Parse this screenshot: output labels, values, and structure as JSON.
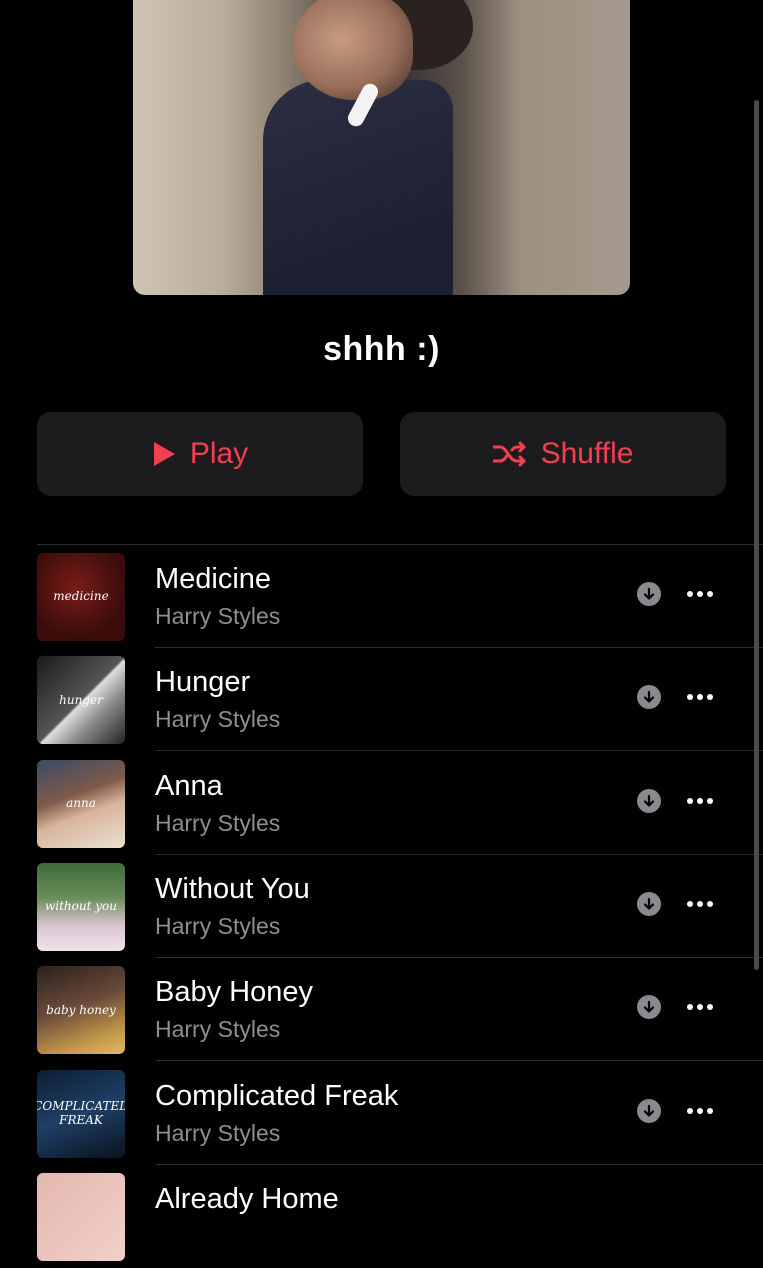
{
  "playlist": {
    "title": "shhh :)",
    "play_label": "Play",
    "shuffle_label": "Shuffle"
  },
  "colors": {
    "accent": "#f2404e",
    "button_bg": "#1c1c1e",
    "secondary_text": "#8e8e93"
  },
  "icons": {
    "download": "download-circle-icon",
    "more": "ellipsis-icon",
    "play": "play-icon",
    "shuffle": "shuffle-icon"
  },
  "tracks": [
    {
      "title": "Medicine",
      "artist": "Harry Styles",
      "art_text": "medicine"
    },
    {
      "title": "Hunger",
      "artist": "Harry Styles",
      "art_text": "hunger"
    },
    {
      "title": "Anna",
      "artist": "Harry Styles",
      "art_text": "anna"
    },
    {
      "title": "Without You",
      "artist": "Harry Styles",
      "art_text": "without you"
    },
    {
      "title": "Baby Honey",
      "artist": "Harry Styles",
      "art_text": "baby honey"
    },
    {
      "title": "Complicated Freak",
      "artist": "Harry Styles",
      "art_text": "COMPLICATED FREAK"
    },
    {
      "title": "Already Home",
      "artist": "",
      "art_text": ""
    }
  ]
}
